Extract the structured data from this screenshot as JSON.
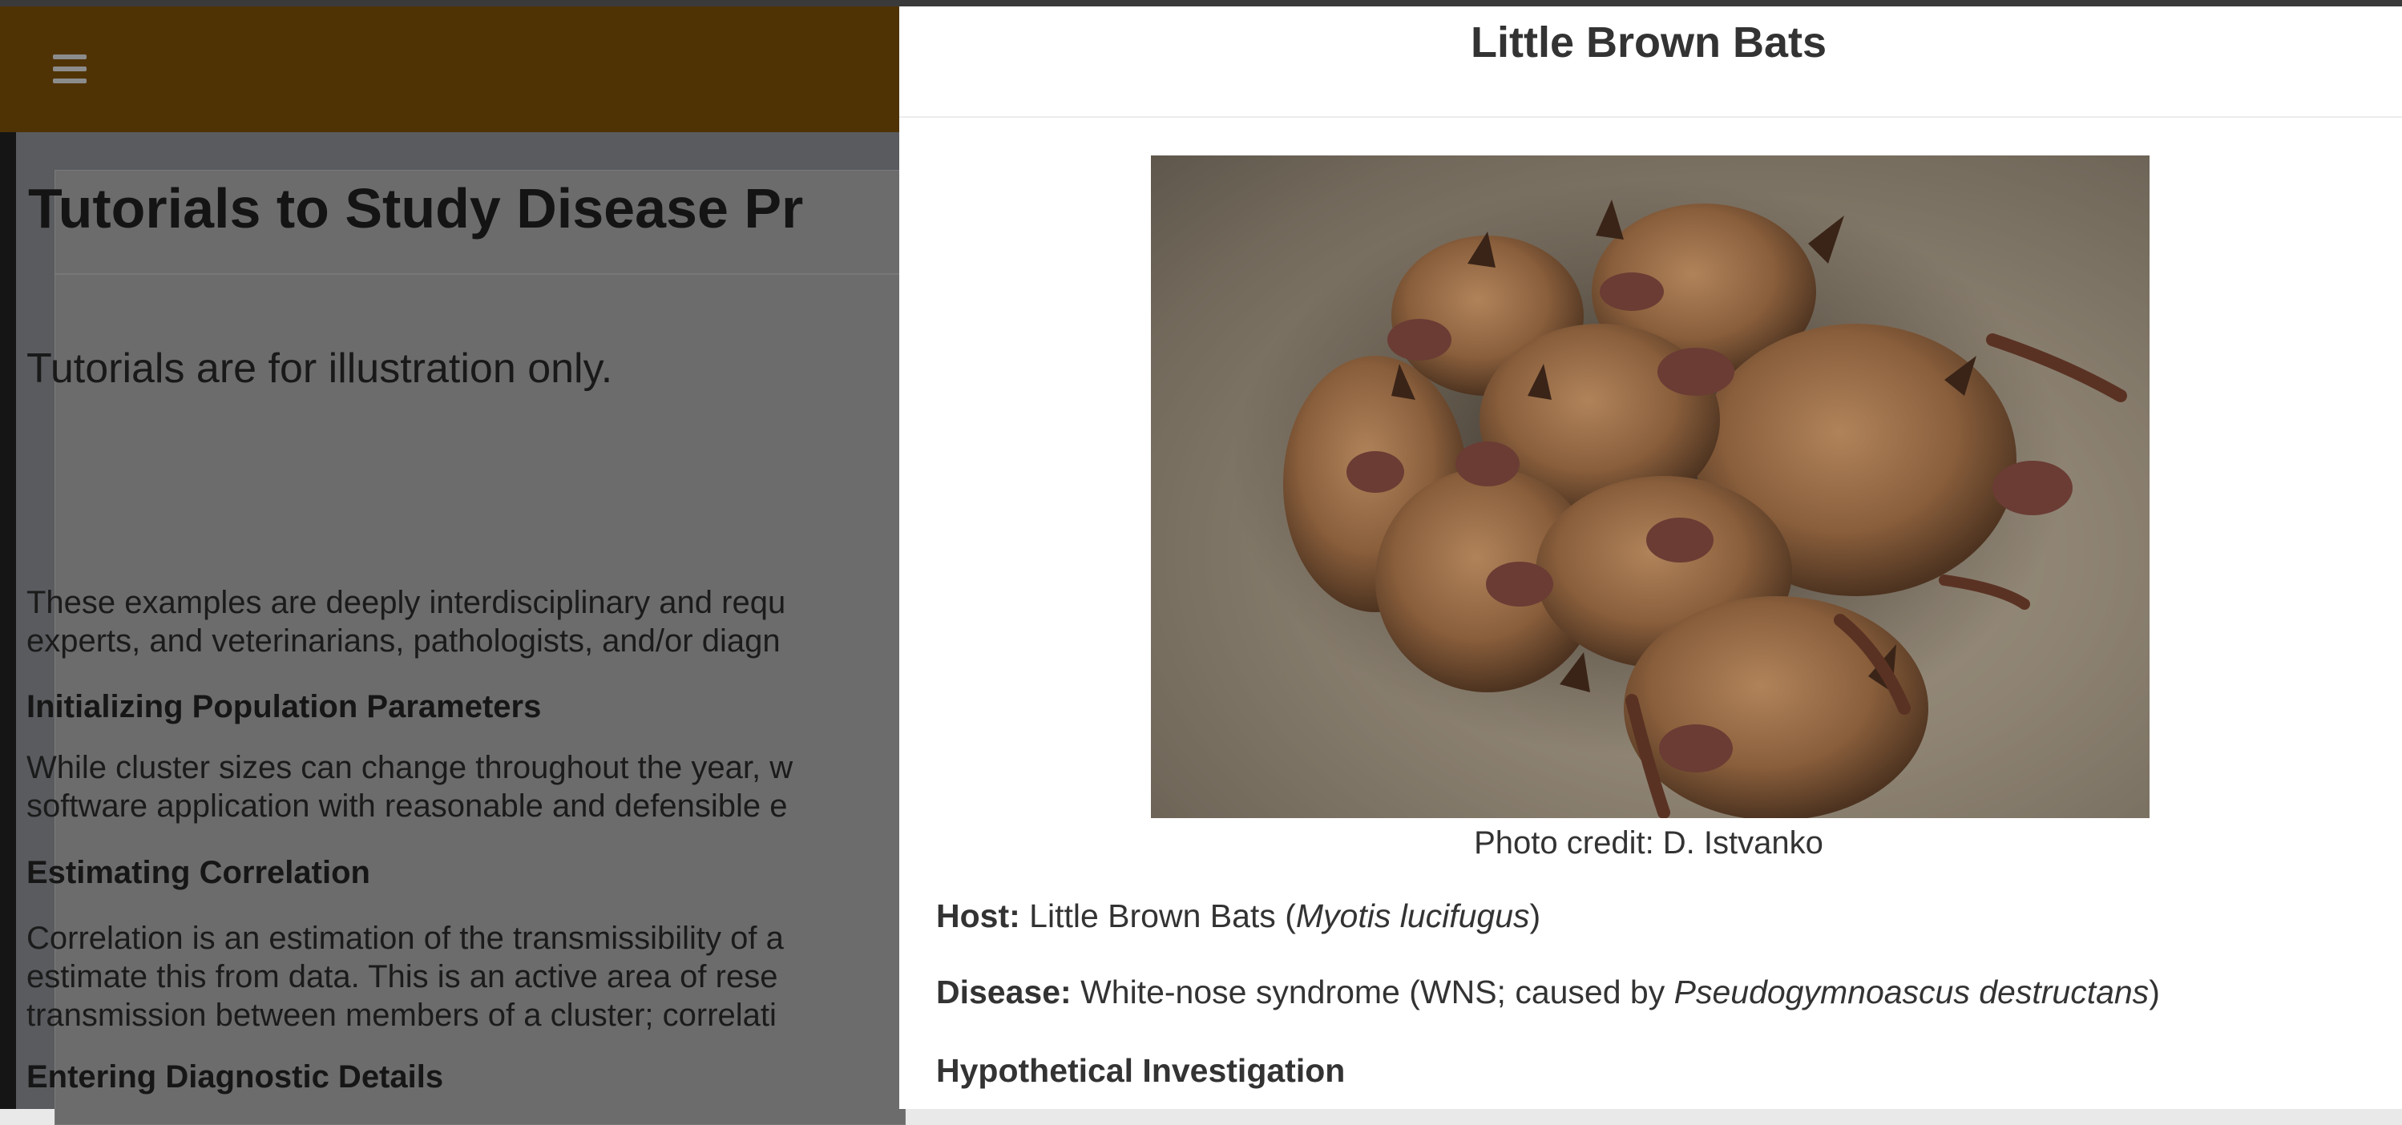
{
  "nav": {
    "menu_icon": "hamburger-menu-icon"
  },
  "page": {
    "title": "Tutorials to Study Disease Pr",
    "lead": "Tutorials are for illustration only.",
    "intro_line1": "These examples are deeply interdisciplinary and requ",
    "intro_line2": "experts, and veterinarians, pathologists, and/or diagn",
    "section1_heading": "Initializing Population Parameters",
    "section1_line1": "While cluster sizes can change throughout the year, w",
    "section1_line2": "software application with reasonable and defensible e",
    "section2_heading": "Estimating Correlation",
    "section2_line1": "Correlation is an estimation of the transmissibility of a",
    "section2_line2": "estimate this from data. This is an active area of rese",
    "section2_line3": "transmission between members of a cluster; correlati",
    "section3_heading": "Entering Diagnostic Details"
  },
  "modal": {
    "title": "Little Brown Bats",
    "photo_credit": "Photo credit: D. Istvanko",
    "host_label": "Host:",
    "host_value": "Little Brown Bats (",
    "host_sci": "Myotis lucifugus",
    "host_close": ")",
    "disease_label": "Disease:",
    "disease_value": "White-nose syndrome (WNS; caused by ",
    "disease_sci": "Pseudogymnoascus destructans",
    "disease_close": ")",
    "hypothetical_heading": "Hypothetical Investigation"
  }
}
